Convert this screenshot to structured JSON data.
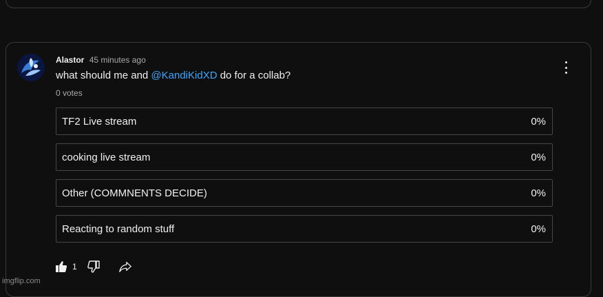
{
  "comment": {
    "author": "Alastor",
    "time": "45 minutes ago",
    "question_prefix": "what should me and ",
    "mention": "@KandiKidXD",
    "question_suffix": " do for a collab?",
    "votes": "0 votes"
  },
  "poll": {
    "options": [
      {
        "label": "TF2 Live stream",
        "percent": "0%"
      },
      {
        "label": "cooking live stream",
        "percent": "0%"
      },
      {
        "label": "Other (COMMNENTS DECIDE)",
        "percent": "0%"
      },
      {
        "label": "Reacting to random stuff",
        "percent": "0%"
      }
    ]
  },
  "actions": {
    "like_count": "1",
    "icons": [
      "thumbs-up-icon",
      "thumbs-down-icon",
      "share-icon",
      "more-vert-icon"
    ]
  },
  "watermark": "imgflip.com",
  "colors": {
    "background": "#0f0f0f",
    "mention": "#3ea6ff",
    "border": "#3a3a3a"
  }
}
